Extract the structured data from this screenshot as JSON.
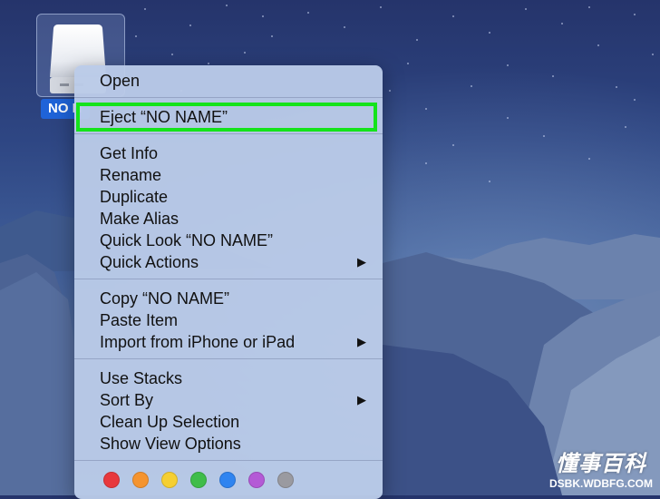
{
  "desktop": {
    "drive_icon": {
      "icon": "external-drive-icon",
      "label": "NO N"
    }
  },
  "context_menu": {
    "groups": [
      [
        {
          "label": "Open"
        }
      ],
      [
        {
          "label": "Eject “NO NAME”",
          "highlighted": true
        }
      ],
      [
        {
          "label": "Get Info"
        },
        {
          "label": "Rename"
        },
        {
          "label": "Duplicate"
        },
        {
          "label": "Make Alias"
        },
        {
          "label": "Quick Look “NO NAME”"
        },
        {
          "label": "Quick Actions",
          "submenu": true
        }
      ],
      [
        {
          "label": "Copy “NO NAME”"
        },
        {
          "label": "Paste Item"
        },
        {
          "label": "Import from iPhone or iPad",
          "submenu": true
        }
      ],
      [
        {
          "label": "Use Stacks"
        },
        {
          "label": "Sort By",
          "submenu": true
        },
        {
          "label": "Clean Up Selection"
        },
        {
          "label": "Show View Options"
        }
      ]
    ],
    "submenu_arrow": "▶",
    "highlight_color": "#14e31b",
    "tag_colors": [
      {
        "name": "red",
        "color": "#e8383d"
      },
      {
        "name": "orange",
        "color": "#f5942f"
      },
      {
        "name": "yellow",
        "color": "#f5cf32"
      },
      {
        "name": "green",
        "color": "#3fbd4a"
      },
      {
        "name": "blue",
        "color": "#2f84f0"
      },
      {
        "name": "purple",
        "color": "#b45ad6"
      },
      {
        "name": "gray",
        "color": "#9a9aa0"
      }
    ]
  },
  "watermark": {
    "chinese": "懂事百科",
    "url": "DSBK.WDBFG.COM"
  }
}
